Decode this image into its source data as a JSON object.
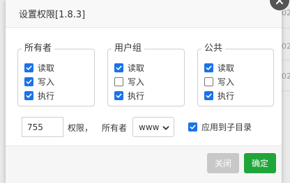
{
  "dialog": {
    "title": "设置权限[1.8.3]"
  },
  "groups": [
    {
      "legend": "所有者",
      "options": [
        {
          "label": "读取",
          "checked": true
        },
        {
          "label": "写入",
          "checked": true
        },
        {
          "label": "执行",
          "checked": true
        }
      ]
    },
    {
      "legend": "用户组",
      "options": [
        {
          "label": "读取",
          "checked": true
        },
        {
          "label": "写入",
          "checked": false
        },
        {
          "label": "执行",
          "checked": true
        }
      ]
    },
    {
      "legend": "公共",
      "options": [
        {
          "label": "读取",
          "checked": true
        },
        {
          "label": "写入",
          "checked": false
        },
        {
          "label": "执行",
          "checked": true
        }
      ]
    }
  ],
  "permission": {
    "value": "755",
    "label": "权限，"
  },
  "owner": {
    "label": "所有者",
    "selected": "www"
  },
  "apply_subdirs": {
    "label": "应用到子目录",
    "checked": true
  },
  "buttons": {
    "close": "关闭",
    "confirm": "确定"
  },
  "background": {
    "fragments": [
      "02",
      "02",
      "02"
    ]
  },
  "colors": {
    "checkbox": "#1a73e8",
    "confirm": "#20a53a",
    "close_btn": "#c8c8c8"
  }
}
